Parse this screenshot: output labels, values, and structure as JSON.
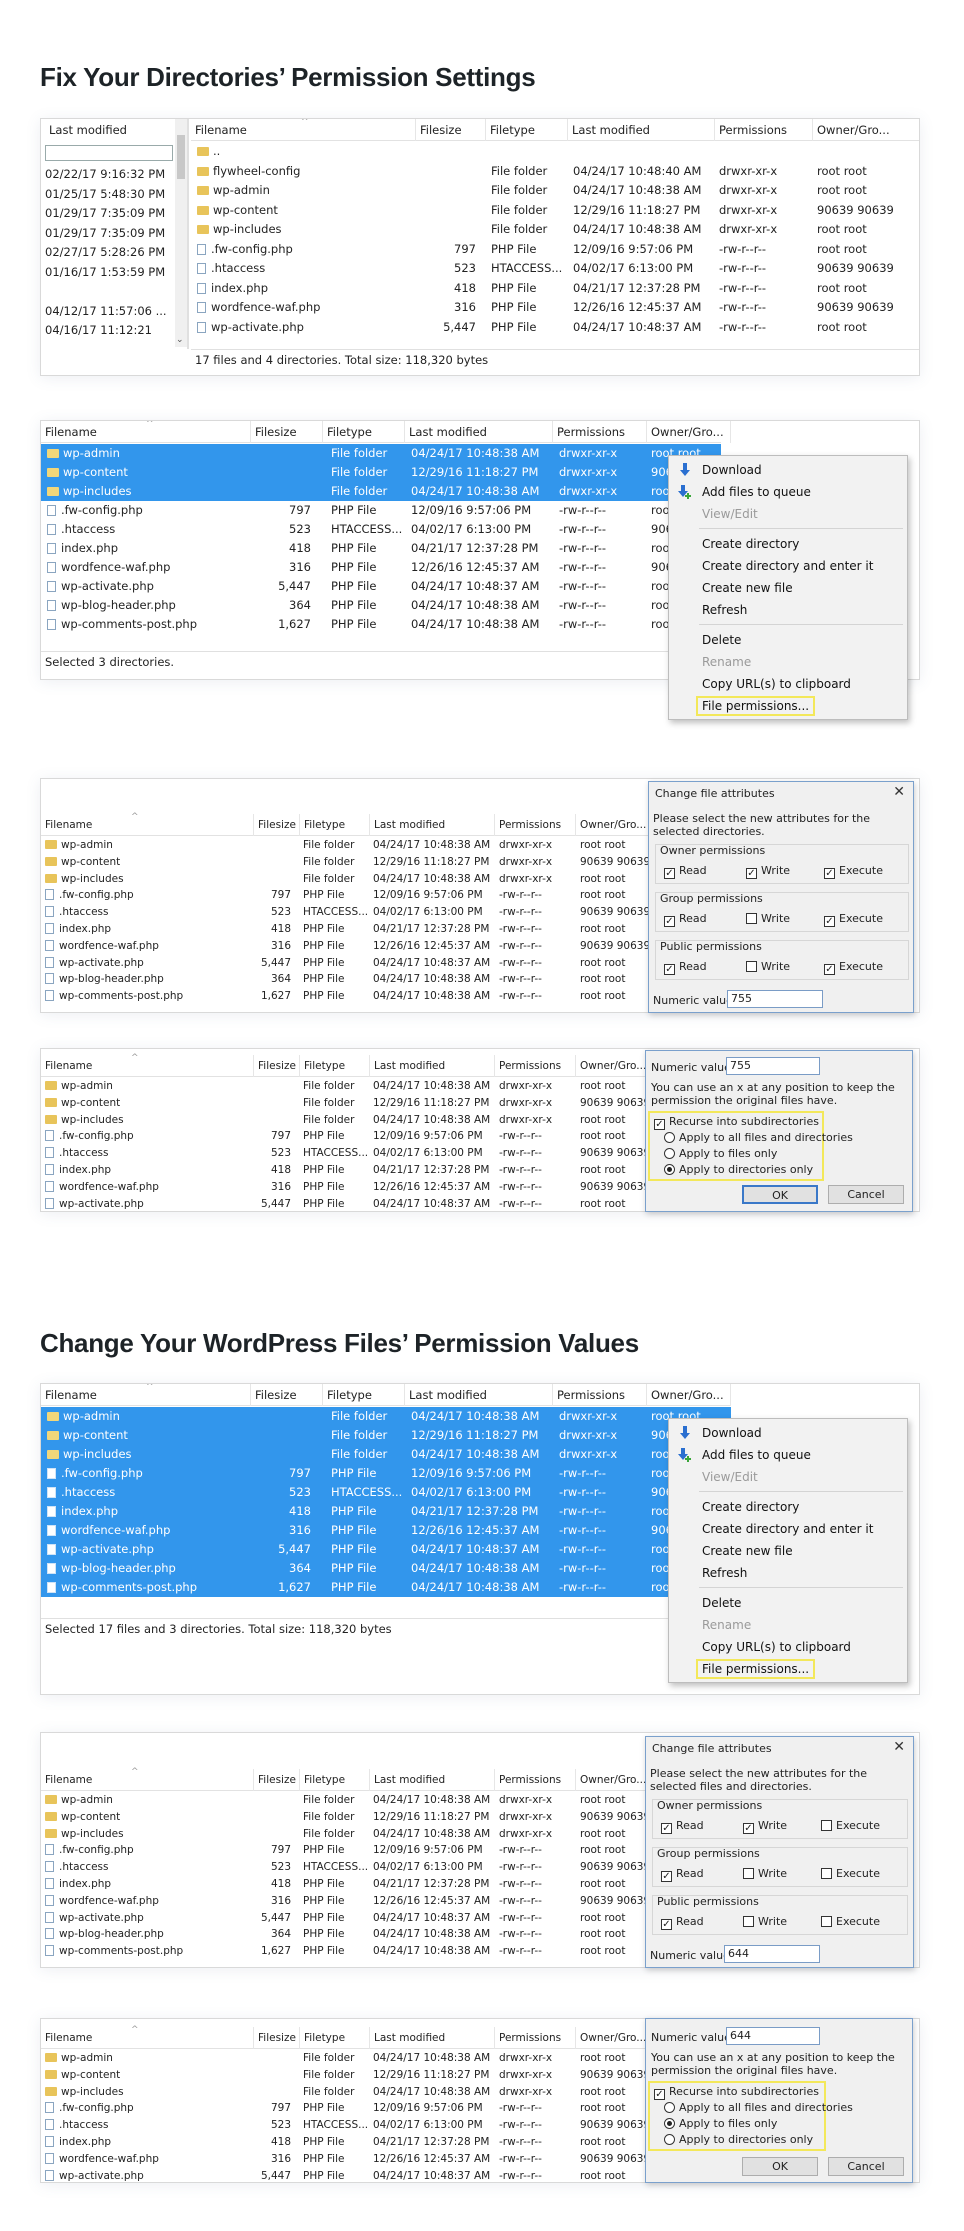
{
  "headings": {
    "h1": "Fix Your Directories’ Permission Settings",
    "h2": "Change Your WordPress Files’ Permission Values"
  },
  "columns": {
    "filename": "Filename",
    "filesize": "Filesize",
    "filetype": "Filetype",
    "lastmod": "Last modified",
    "perms": "Permissions",
    "owner": "Owner/Gro..."
  },
  "panel1": {
    "left_header": "Last modified",
    "left_dates": [
      "02/22/17 9:16:32 PM",
      "01/25/17 5:48:30 PM",
      "01/29/17 7:35:09 PM",
      "01/29/17 7:35:09 PM",
      "02/27/17 5:28:26 PM",
      "01/16/17 1:53:59 PM",
      "",
      "04/12/17 11:57:06 ...",
      "04/16/17 11:12:21"
    ],
    "rows": [
      {
        "name": "..",
        "size": "",
        "type": "",
        "mod": "",
        "perm": "",
        "owner": "",
        "kind": "folder"
      },
      {
        "name": "flywheel-config",
        "size": "",
        "type": "File folder",
        "mod": "04/24/17 10:48:40 AM",
        "perm": "drwxr-xr-x",
        "owner": "root root",
        "kind": "folder"
      },
      {
        "name": "wp-admin",
        "size": "",
        "type": "File folder",
        "mod": "04/24/17 10:48:38 AM",
        "perm": "drwxr-xr-x",
        "owner": "root root",
        "kind": "folder"
      },
      {
        "name": "wp-content",
        "size": "",
        "type": "File folder",
        "mod": "12/29/16 11:18:27 PM",
        "perm": "drwxr-xr-x",
        "owner": "90639 90639",
        "kind": "folder"
      },
      {
        "name": "wp-includes",
        "size": "",
        "type": "File folder",
        "mod": "04/24/17 10:48:38 AM",
        "perm": "drwxr-xr-x",
        "owner": "root root",
        "kind": "folder"
      },
      {
        "name": ".fw-config.php",
        "size": "797",
        "type": "PHP File",
        "mod": "12/09/16 9:57:06 PM",
        "perm": "-rw-r--r--",
        "owner": "root root",
        "kind": "file"
      },
      {
        "name": ".htaccess",
        "size": "523",
        "type": "HTACCESS...",
        "mod": "04/02/17 6:13:00 PM",
        "perm": "-rw-r--r--",
        "owner": "90639 90639",
        "kind": "file"
      },
      {
        "name": "index.php",
        "size": "418",
        "type": "PHP File",
        "mod": "04/21/17 12:37:28 PM",
        "perm": "-rw-r--r--",
        "owner": "root root",
        "kind": "file"
      },
      {
        "name": "wordfence-waf.php",
        "size": "316",
        "type": "PHP File",
        "mod": "12/26/16 12:45:37 AM",
        "perm": "-rw-r--r--",
        "owner": "90639 90639",
        "kind": "file"
      },
      {
        "name": "wp-activate.php",
        "size": "5,447",
        "type": "PHP File",
        "mod": "04/24/17 10:48:37 AM",
        "perm": "-rw-r--r--",
        "owner": "root root",
        "kind": "file"
      }
    ],
    "status": "17 files and 4 directories. Total size: 118,320 bytes"
  },
  "list_rows": [
    {
      "name": "wp-admin",
      "size": "",
      "type": "File folder",
      "mod": "04/24/17 10:48:38 AM",
      "perm": "drwxr-xr-x",
      "owner": "root root",
      "kind": "folder"
    },
    {
      "name": "wp-content",
      "size": "",
      "type": "File folder",
      "mod": "12/29/16 11:18:27 PM",
      "perm": "drwxr-xr-x",
      "owner": "90639 90639",
      "kind": "folder"
    },
    {
      "name": "wp-includes",
      "size": "",
      "type": "File folder",
      "mod": "04/24/17 10:48:38 AM",
      "perm": "drwxr-xr-x",
      "owner": "root root",
      "kind": "folder"
    },
    {
      "name": ".fw-config.php",
      "size": "797",
      "type": "PHP File",
      "mod": "12/09/16 9:57:06 PM",
      "perm": "-rw-r--r--",
      "owner": "root root",
      "kind": "file"
    },
    {
      "name": ".htaccess",
      "size": "523",
      "type": "HTACCESS...",
      "mod": "04/02/17 6:13:00 PM",
      "perm": "-rw-r--r--",
      "owner": "90639 90639",
      "kind": "file"
    },
    {
      "name": "index.php",
      "size": "418",
      "type": "PHP File",
      "mod": "04/21/17 12:37:28 PM",
      "perm": "-rw-r--r--",
      "owner": "root root",
      "kind": "file"
    },
    {
      "name": "wordfence-waf.php",
      "size": "316",
      "type": "PHP File",
      "mod": "12/26/16 12:45:37 AM",
      "perm": "-rw-r--r--",
      "owner": "90639 90639",
      "kind": "file"
    },
    {
      "name": "wp-activate.php",
      "size": "5,447",
      "type": "PHP File",
      "mod": "04/24/17 10:48:37 AM",
      "perm": "-rw-r--r--",
      "owner": "root root",
      "kind": "file"
    },
    {
      "name": "wp-blog-header.php",
      "size": "364",
      "type": "PHP File",
      "mod": "04/24/17 10:48:38 AM",
      "perm": "-rw-r--r--",
      "owner": "root root",
      "kind": "file"
    },
    {
      "name": "wp-comments-post.php",
      "size": "1,627",
      "type": "PHP File",
      "mod": "04/24/17 10:48:38 AM",
      "perm": "-rw-r--r--",
      "owner": "root root",
      "kind": "file"
    }
  ],
  "statusbars": {
    "p2": "Selected 3 directories.",
    "p6": "Selected 17 files and 3 directories. Total size: 118,320 bytes"
  },
  "context_menu": {
    "download": "Download",
    "add_queue": "Add files to queue",
    "view_edit": "View/Edit",
    "create_dir": "Create directory",
    "create_dir_enter": "Create directory and enter it",
    "create_file": "Create new file",
    "refresh": "Refresh",
    "delete": "Delete",
    "rename": "Rename",
    "copy_url": "Copy URL(s) to clipboard",
    "file_perms": "File permissions..."
  },
  "dialog_dirs": {
    "title": "Change file attributes",
    "desc": "Please select the new attributes for the selected directories.",
    "owner": "Owner permissions",
    "group": "Group permissions",
    "public": "Public permissions",
    "read": "Read",
    "write": "Write",
    "execute": "Execute",
    "owner_checks": [
      "✓",
      "✓",
      "✓"
    ],
    "group_checks": [
      "✓",
      "",
      "✓"
    ],
    "public_checks": [
      "✓",
      "",
      "✓"
    ],
    "numeric_label": "Numeric value:",
    "numeric_value": "755",
    "x_note": "You can use an x at any position to keep the permission the original files have.",
    "recurse": "Recurse into subdirectories",
    "opt_all": "Apply to all files and directories",
    "opt_files": "Apply to files only",
    "opt_dirs": "Apply to directories only",
    "ok": "OK",
    "cancel": "Cancel"
  },
  "dialog_files": {
    "title": "Change file attributes",
    "desc": "Please select the new attributes for the selected files and directories.",
    "owner_checks": [
      "✓",
      "✓",
      ""
    ],
    "group_checks": [
      "✓",
      "",
      ""
    ],
    "public_checks": [
      "✓",
      "",
      ""
    ],
    "numeric_value": "644"
  },
  "colors": {
    "selection": "#3296ec",
    "highlight": "#f3e85a",
    "folder": "#e8c45a"
  }
}
